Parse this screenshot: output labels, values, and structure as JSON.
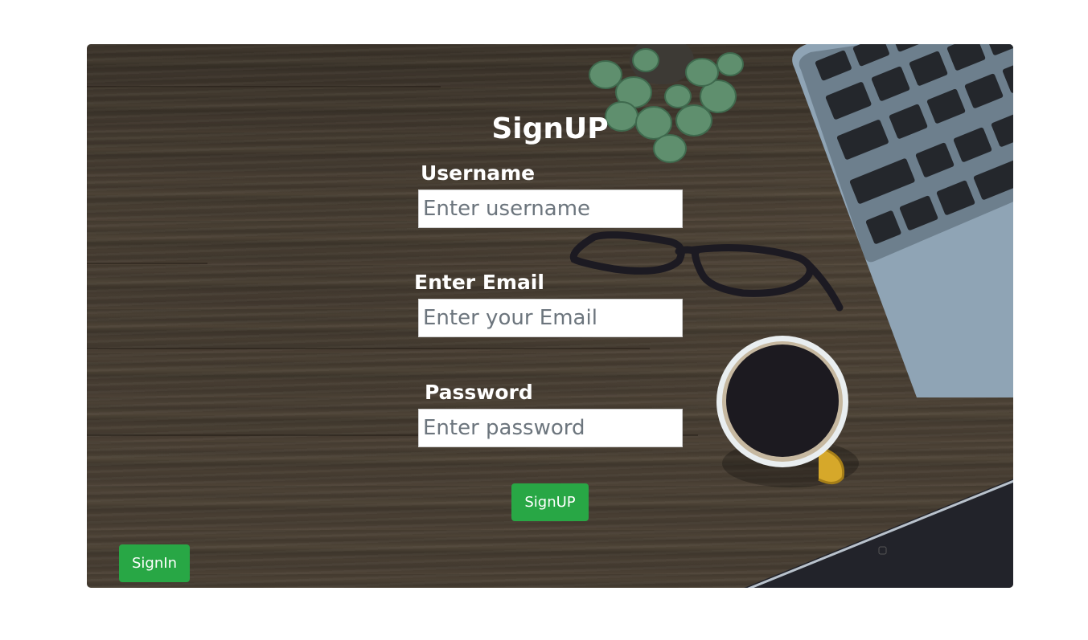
{
  "form": {
    "title": "SignUP",
    "username": {
      "label": "Username",
      "placeholder": "Enter username",
      "value": ""
    },
    "email": {
      "label": "Enter Email",
      "placeholder": "Enter your Email",
      "value": ""
    },
    "password": {
      "label": "Password",
      "placeholder": "Enter password",
      "value": ""
    },
    "submit_label": "SignUP"
  },
  "signin_label": "SignIn",
  "colors": {
    "button_green": "#28a745",
    "text_white": "#ffffff"
  }
}
